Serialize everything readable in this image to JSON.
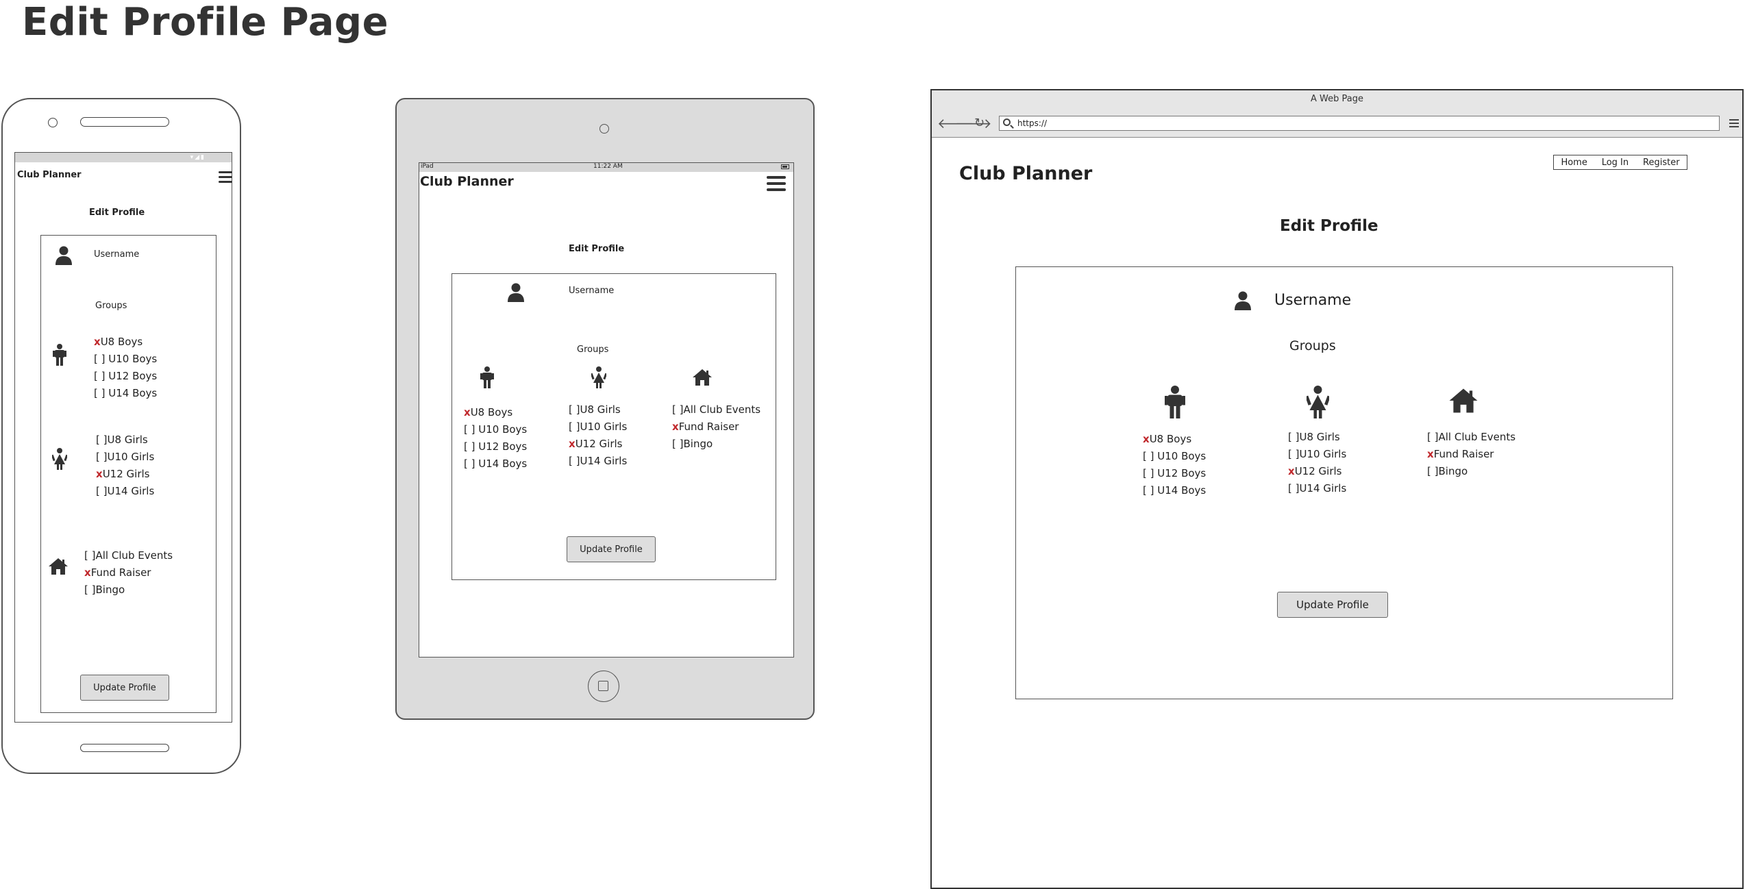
{
  "page_title": "Edit Profile Page",
  "app": {
    "logo": "Club Planner",
    "heading": "Edit Profile",
    "username_label": "Username",
    "groups_label": "Groups",
    "update_button": "Update Profile"
  },
  "groups": {
    "boys": [
      {
        "mark": "x",
        "label": "U8 Boys"
      },
      {
        "mark": "[ ] ",
        "label": "U10 Boys"
      },
      {
        "mark": "[ ] ",
        "label": "U12 Boys"
      },
      {
        "mark": "[ ] ",
        "label": "U14 Boys"
      }
    ],
    "girls": [
      {
        "mark": "[ ]",
        "label": "U8 Girls"
      },
      {
        "mark": "[ ]",
        "label": "U10 Girls"
      },
      {
        "mark": "x",
        "label": "U12 Girls"
      },
      {
        "mark": "[ ]",
        "label": "U14 Girls"
      }
    ],
    "events": [
      {
        "mark": "[ ]",
        "label": "All Club Events"
      },
      {
        "mark": "x",
        "label": "Fund Raiser"
      },
      {
        "mark": "[ ]",
        "label": "Bingo"
      }
    ]
  },
  "tablet_status": {
    "carrier": "iPad",
    "time": "11:22 AM"
  },
  "browser": {
    "window_title": "A Web Page",
    "url": "https://",
    "nav": [
      "Home",
      "Log In",
      "Register"
    ]
  },
  "icons": [
    "user-icon",
    "boy-icon",
    "girl-icon",
    "home-icon",
    "hamburger-icon"
  ],
  "colors": {
    "checked_mark": "#c0282c",
    "device_frame": "#555555",
    "button_bg": "#dedede",
    "status_bar": "#d6d6d6"
  }
}
